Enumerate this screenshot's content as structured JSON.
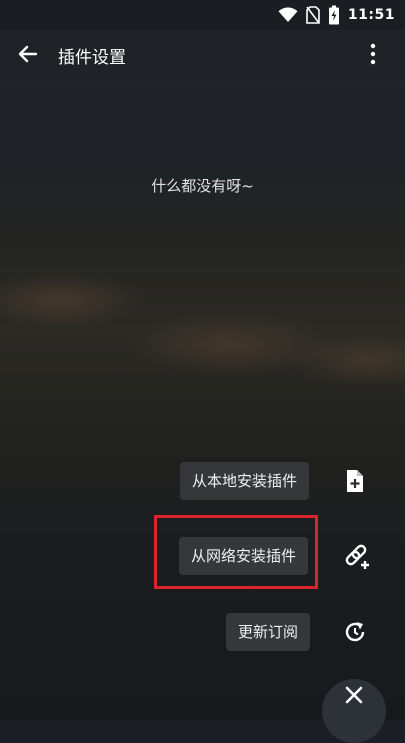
{
  "status": {
    "time": "11:51"
  },
  "appbar": {
    "title": "插件设置"
  },
  "empty": {
    "message": "什么都没有呀~"
  },
  "fab_menu": {
    "local_install": "从本地安装插件",
    "network_install": "从网络安装插件",
    "update_subscription": "更新订阅"
  }
}
